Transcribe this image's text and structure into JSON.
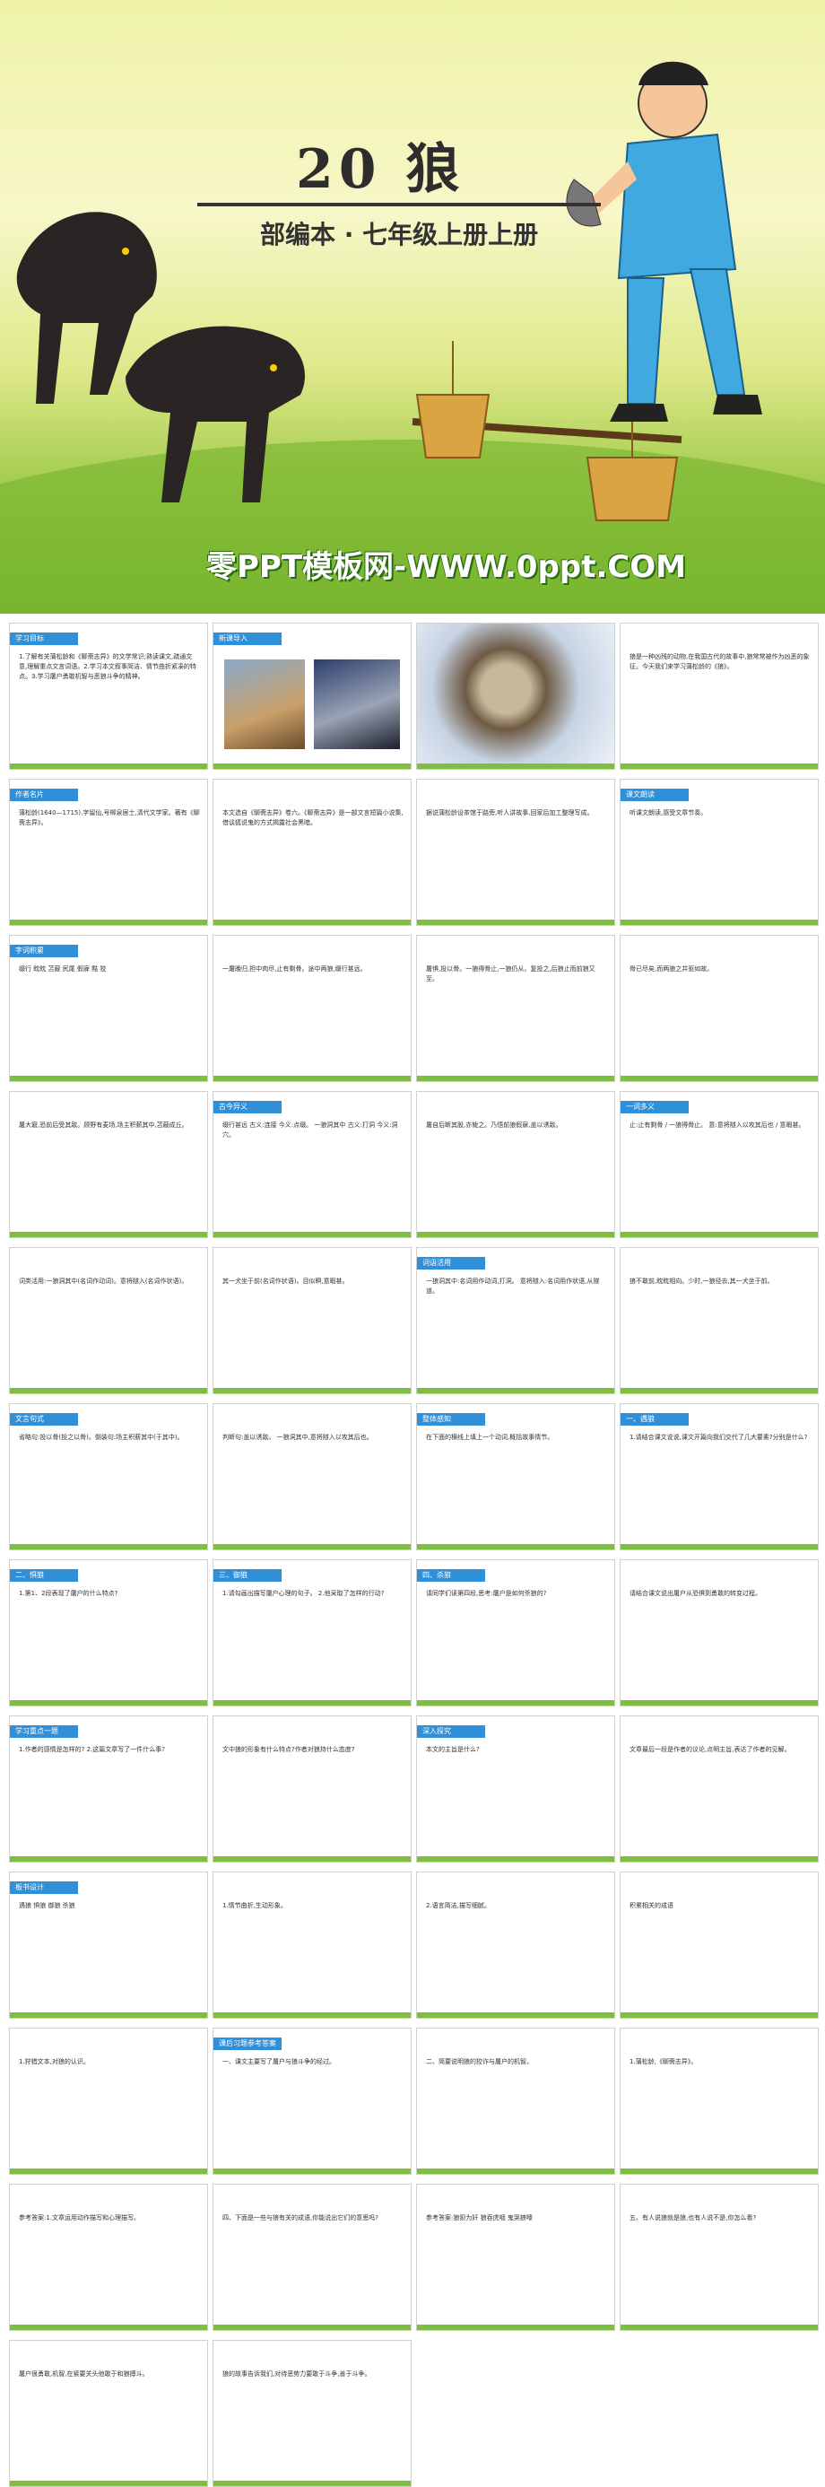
{
  "cover": {
    "title": "20 狼",
    "subtitle": "部编本 · 七年级上册上册",
    "brand": "零PPT模板网-WWW.0ppt.COM"
  },
  "slides": [
    {
      "hdr": "学习目标",
      "text": "1.了解有关蒲松龄和《聊斋志异》的文学常识;熟读课文,疏通文意,理解重点文言词语。2.学习本文叙事简洁、情节曲折紧凑的特点。3.学习屠户勇敢机智与恶狼斗争的精神。"
    },
    {
      "hdr": "新课导入",
      "text": ""
    },
    {
      "hdr": "",
      "text": ""
    },
    {
      "hdr": "",
      "text": "狼是一种凶残的动物,在我国古代的故事中,狼常常被作为凶恶的象征。今天我们来学习蒲松龄的《狼》。"
    },
    {
      "hdr": "作者名片",
      "text": "蒲松龄(1640—1715),字留仙,号柳泉居士,清代文学家。著有《聊斋志异》。"
    },
    {
      "hdr": "",
      "text": "本文选自《聊斋志异》卷六。《聊斋志异》是一部文言短篇小说集,借谈狐说鬼的方式揭露社会黑暗。"
    },
    {
      "hdr": "",
      "text": "据说蒲松龄设茶馆于路旁,听人讲故事,回家后加工整理写成。"
    },
    {
      "hdr": "课文朗读",
      "text": "听课文朗读,感受文章节奏。"
    },
    {
      "hdr": "字词积累",
      "text": "缀行 眈眈 苫蔽 尻尾 假寐 黠 狡"
    },
    {
      "hdr": "",
      "text": "一屠晚归,担中肉尽,止有剩骨。途中两狼,缀行甚远。"
    },
    {
      "hdr": "",
      "text": "屠惧,投以骨。一狼得骨止,一狼仍从。复投之,后狼止而前狼又至。"
    },
    {
      "hdr": "",
      "text": "骨已尽矣,而两狼之并驱如故。"
    },
    {
      "hdr": "",
      "text": "屠大窘,恐前后受其敌。顾野有麦场,场主积薪其中,苫蔽成丘。"
    },
    {
      "hdr": "古今异义",
      "text": "缀行甚远 古义:连接 今义:点缀。 一狼洞其中 古义:打洞 今义:洞穴。"
    },
    {
      "hdr": "",
      "text": "屠自后断其股,亦毙之。乃悟前狼假寐,盖以诱敌。"
    },
    {
      "hdr": "一词多义",
      "text": "止:止有剩骨 / 一狼得骨止。 意:意将隧入以攻其后也 / 意暇甚。"
    },
    {
      "hdr": "",
      "text": "词类活用:一狼洞其中(名词作动词)。意将隧入(名词作状语)。"
    },
    {
      "hdr": "",
      "text": "其一犬坐于前(名词作状语)。目似瞑,意暇甚。"
    },
    {
      "hdr": "词语活用",
      "text": "一狼洞其中:名词用作动词,打洞。 意将隧入:名词用作状语,从隧道。"
    },
    {
      "hdr": "",
      "text": "狼不敢前,眈眈相向。少时,一狼径去,其一犬坐于前。"
    },
    {
      "hdr": "文言句式",
      "text": "省略句:投以骨(投之以骨)。倒装句:场主积薪其中(于其中)。"
    },
    {
      "hdr": "",
      "text": "判断句:盖以诱敌。 一狼洞其中,意将隧入以攻其后也。"
    },
    {
      "hdr": "整体感知",
      "text": "在下面的横线上填上一个动词,概括故事情节。"
    },
    {
      "hdr": "一、遇狼",
      "text": "1.请结合课文说说,课文开篇向我们交代了几大要素?分别是什么?"
    },
    {
      "hdr": "二、惧狼",
      "text": "1.第1、2段表现了屠户的什么特点?"
    },
    {
      "hdr": "三、御狼",
      "text": "1.请勾画出描写屠户心理的句子。 2.他采取了怎样的行动?"
    },
    {
      "hdr": "四、杀狼",
      "text": "请同学们读第四段,思考:屠户是如何杀狼的?"
    },
    {
      "hdr": "",
      "text": "请结合课文说出屠户从恐惧到勇敢的转变过程。"
    },
    {
      "hdr": "学习重点一题",
      "text": "1.作者的感情是怎样的? 2.这篇文章写了一件什么事?"
    },
    {
      "hdr": "",
      "text": "文中狼的形象有什么特点?作者对狼持什么态度?"
    },
    {
      "hdr": "深入探究",
      "text": "本文的主旨是什么?"
    },
    {
      "hdr": "",
      "text": "文章最后一段是作者的议论,点明主旨,表达了作者的见解。"
    },
    {
      "hdr": "板书设计",
      "text": "遇狼 惧狼 御狼 杀狼"
    },
    {
      "hdr": "",
      "text": "1.情节曲折,生动形象。"
    },
    {
      "hdr": "",
      "text": "2.语言简洁,描写细腻。"
    },
    {
      "hdr": "",
      "text": "积累相关的成语"
    },
    {
      "hdr": "",
      "text": "1.狩猎文本,对狼的认识。"
    },
    {
      "hdr": "课后习题参考答案",
      "text": "一、课文主要写了屠户与狼斗争的经过。"
    },
    {
      "hdr": "",
      "text": "二、简要说明狼的狡诈与屠户的机智。"
    },
    {
      "hdr": "",
      "text": "1.蒲松龄,《聊斋志异》。"
    },
    {
      "hdr": "",
      "text": "参考答案:1.文章运用动作描写和心理描写。"
    },
    {
      "hdr": "",
      "text": "四、下面是一些与狼有关的成语,你能说出它们的意思吗?"
    },
    {
      "hdr": "",
      "text": "参考答案:狼狈为奸 狼吞虎咽 鬼哭狼嚎"
    },
    {
      "hdr": "",
      "text": "五、有人说狼就是狼,也有人说不是,你怎么看?"
    },
    {
      "hdr": "",
      "text": "屠户很勇敢,机智,在紧要关头他敢于和狼搏斗。"
    },
    {
      "hdr": "",
      "text": "狼的故事告诉我们,对待恶势力要敢于斗争,善于斗争。"
    }
  ]
}
